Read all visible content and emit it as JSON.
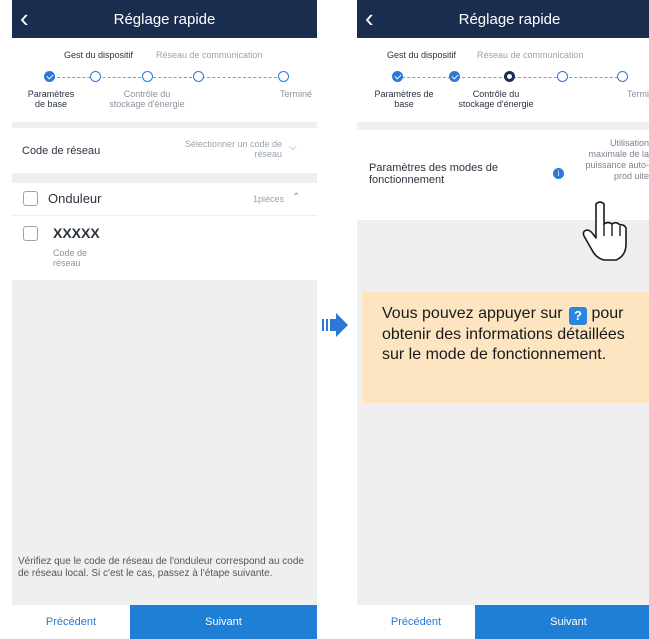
{
  "left_screen": {
    "header": {
      "back_icon": "chevron-left-icon",
      "title": "Réglage rapide"
    },
    "stepper": {
      "group1": "Gest du dispositif",
      "group2": "Réseau de communication",
      "steps": [
        "Paramètres de base",
        "Contrôle du stockage d'énergie",
        "Terminé"
      ]
    },
    "grid_code": {
      "label": "Code de réseau",
      "placeholder": "Sélectionner un code de réseau"
    },
    "inverter": {
      "label": "Onduleur",
      "count": "1pièces",
      "item_name": "XXXXX",
      "item_sub": "Code de réseau"
    },
    "note": "Vérifiez que le code de réseau de l'onduleur correspond au code de réseau local. Si c'est le cas, passez à l'étape suivante.",
    "buttons": {
      "prev": "Précédent",
      "next": "Suivant"
    }
  },
  "right_screen": {
    "header": {
      "back_icon": "chevron-left-icon",
      "title": "Réglage rapide"
    },
    "stepper": {
      "group1": "Gest du dispositif",
      "group2": "Réseau de communication",
      "steps": [
        "Paramètres de base",
        "Contrôle du stockage d'énergie",
        "Terminé"
      ]
    },
    "mode_setting": {
      "label": "Paramètres des modes de fonctionnement",
      "value": "Utilisation maximale de la puissance auto-prod uite",
      "info_icon": "info-icon"
    },
    "buttons": {
      "prev": "Précédent",
      "next": "Suivant"
    }
  },
  "callout": {
    "text_before": "Vous pouvez appuyer sur",
    "text_after": "pour obtenir des informations détaillées sur le mode de fonctionnement.",
    "icon_label": "?"
  },
  "colors": {
    "header": "#1b2d4e",
    "accent": "#2b78d8",
    "next_button": "#1f7fd4",
    "callout": "#fce5c0"
  }
}
